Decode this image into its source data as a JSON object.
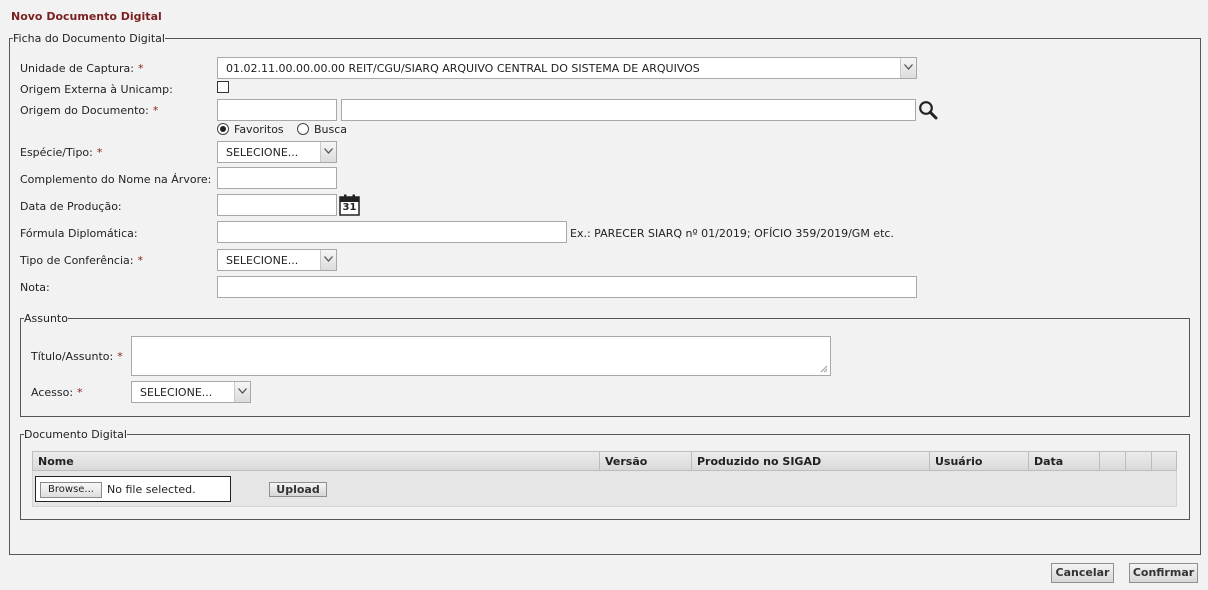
{
  "page": {
    "title": "Novo Documento Digital"
  },
  "ficha": {
    "legend": "Ficha do Documento Digital",
    "unidade_captura": {
      "label": "Unidade de Captura:",
      "value": "01.02.11.00.00.00.00 REIT/CGU/SIARQ ARQUIVO CENTRAL DO SISTEMA DE ARQUIVOS"
    },
    "origem_externa": {
      "label": "Origem Externa à Unicamp:",
      "checked": false
    },
    "origem_documento": {
      "label": "Origem do Documento:",
      "code_value": "",
      "name_value": "",
      "options": {
        "favoritos": "Favoritos",
        "busca": "Busca",
        "selected": "favoritos"
      }
    },
    "especie_tipo": {
      "label": "Espécie/Tipo:",
      "value": "SELECIONE..."
    },
    "complemento": {
      "label": "Complemento do Nome na Árvore:",
      "value": ""
    },
    "data_producao": {
      "label": "Data de Produção:",
      "value": "",
      "calendar_day": "31"
    },
    "formula": {
      "label": "Fórmula Diplomática:",
      "value": "",
      "hint": "Ex.: PARECER SIARQ nº 01/2019; OFÍCIO 359/2019/GM etc."
    },
    "tipo_conferencia": {
      "label": "Tipo de Conferência:",
      "value": "SELECIONE..."
    },
    "nota": {
      "label": "Nota:",
      "value": ""
    },
    "required_mark": "*"
  },
  "assunto": {
    "legend": "Assunto",
    "titulo": {
      "label": "Título/Assunto:"
    },
    "acesso": {
      "label": "Acesso:",
      "value": "SELECIONE..."
    }
  },
  "documento_digital": {
    "legend": "Documento Digital",
    "columns": [
      "Nome",
      "Versão",
      "Produzido no SIGAD",
      "Usuário",
      "Data"
    ],
    "browse_label": "Browse...",
    "file_status": "No file selected.",
    "upload_label": "Upload"
  },
  "actions": {
    "cancel": "Cancelar",
    "confirm": "Confirmar"
  }
}
